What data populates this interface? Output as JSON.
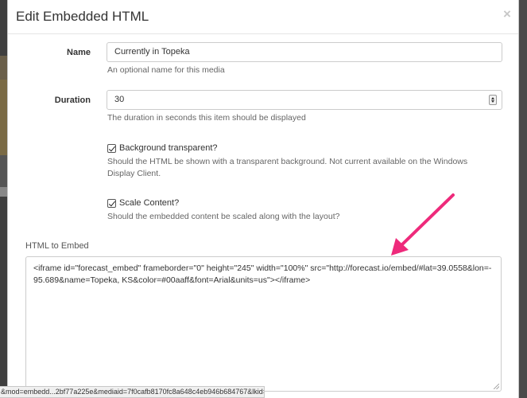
{
  "modal": {
    "title": "Edit Embedded HTML",
    "close_label": "×"
  },
  "fields": {
    "name": {
      "label": "Name",
      "value": "Currently in Topeka",
      "help": "An optional name for this media"
    },
    "duration": {
      "label": "Duration",
      "value": "30",
      "help": "The duration in seconds this item should be displayed"
    },
    "background_transparent": {
      "label": "Background transparent?",
      "checked": true,
      "help": "Should the HTML be shown with a transparent background. Not current available on the Windows Display Client."
    },
    "scale_content": {
      "label": "Scale Content?",
      "checked": true,
      "help": "Should the embedded content be scaled along with the layout?"
    },
    "html_embed": {
      "label": "HTML to Embed",
      "value": "<iframe id=\"forecast_embed\" frameborder=\"0\" height=\"245\" width=\"100%\" src=\"http://forecast.io/embed/#lat=39.0558&lon=-95.689&name=Topeka, KS&color=#00aaff&font=Arial&units=us\"></iframe>"
    }
  },
  "status_bar": {
    "url": "&mod=embedd...2bf77a225e&mediaid=7f0cafb8170fc8a648c4eb946b684767&lkid="
  },
  "colors": {
    "annotation_arrow": "#ee2a7b"
  }
}
